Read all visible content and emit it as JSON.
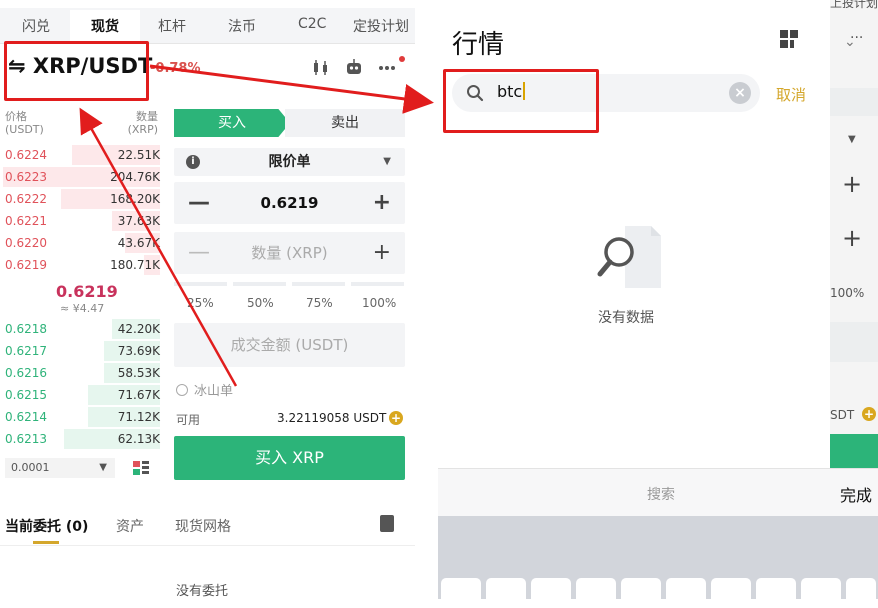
{
  "left": {
    "top_tabs": [
      "闪兑",
      "现货",
      "杠杆",
      "法币",
      "C2C",
      "定投计划"
    ],
    "active_tab": "现货",
    "pair": "⇋ XRP/USDT",
    "change": "-0.78%",
    "orderbook": {
      "price_header": "价格",
      "price_unit": "(USDT)",
      "qty_header": "数量",
      "qty_unit": "(XRP)",
      "asks": [
        {
          "price": "0.6224",
          "qty": "22.51K",
          "depth": 0.55
        },
        {
          "price": "0.6223",
          "qty": "204.76K",
          "depth": 0.98
        },
        {
          "price": "0.6222",
          "qty": "168.20K",
          "depth": 0.62
        },
        {
          "price": "0.6221",
          "qty": "37.63K",
          "depth": 0.3
        },
        {
          "price": "0.6220",
          "qty": "43.67K",
          "depth": 0.22
        },
        {
          "price": "0.6219",
          "qty": "180.71K",
          "depth": 0.1
        }
      ],
      "mid_price": "0.6219",
      "mid_cny": "≈ ¥4.47",
      "bids": [
        {
          "price": "0.6218",
          "qty": "42.20K",
          "depth": 0.3
        },
        {
          "price": "0.6217",
          "qty": "73.69K",
          "depth": 0.35
        },
        {
          "price": "0.6216",
          "qty": "58.53K",
          "depth": 0.35
        },
        {
          "price": "0.6215",
          "qty": "71.67K",
          "depth": 0.45
        },
        {
          "price": "0.6214",
          "qty": "71.12K",
          "depth": 0.45
        },
        {
          "price": "0.6213",
          "qty": "62.13K",
          "depth": 0.6
        }
      ],
      "tick_size": "0.0001"
    },
    "form": {
      "buy_tab": "买入",
      "sell_tab": "卖出",
      "order_type": "限价单",
      "price": "0.6219",
      "qty_placeholder": "数量 (XRP)",
      "percent_options": [
        "25%",
        "50%",
        "75%",
        "100%"
      ],
      "amount_placeholder": "成交金额 (USDT)",
      "iceberg_label": "冰山单",
      "available_label": "可用",
      "available_value": "3.22119058 USDT",
      "buy_button": "买入 XRP"
    },
    "bottom_tabs": [
      "当前委托 (0)",
      "资产",
      "现货网格"
    ],
    "no_orders": "没有委托"
  },
  "right": {
    "title": "行情",
    "search_value": "btc",
    "cancel": "取消",
    "empty_text": "没有数据",
    "keyboard_placeholder": "搜索",
    "keyboard_done": "完成"
  },
  "sliver": {
    "top_text": "上投计划",
    "percent_text": "100%",
    "avail_text": "SDT"
  },
  "colors": {
    "buy_green": "#2cb479",
    "ask_red": "#e0525a",
    "accent_gold": "#d4a72c",
    "highlight_red": "#e11d1d"
  }
}
